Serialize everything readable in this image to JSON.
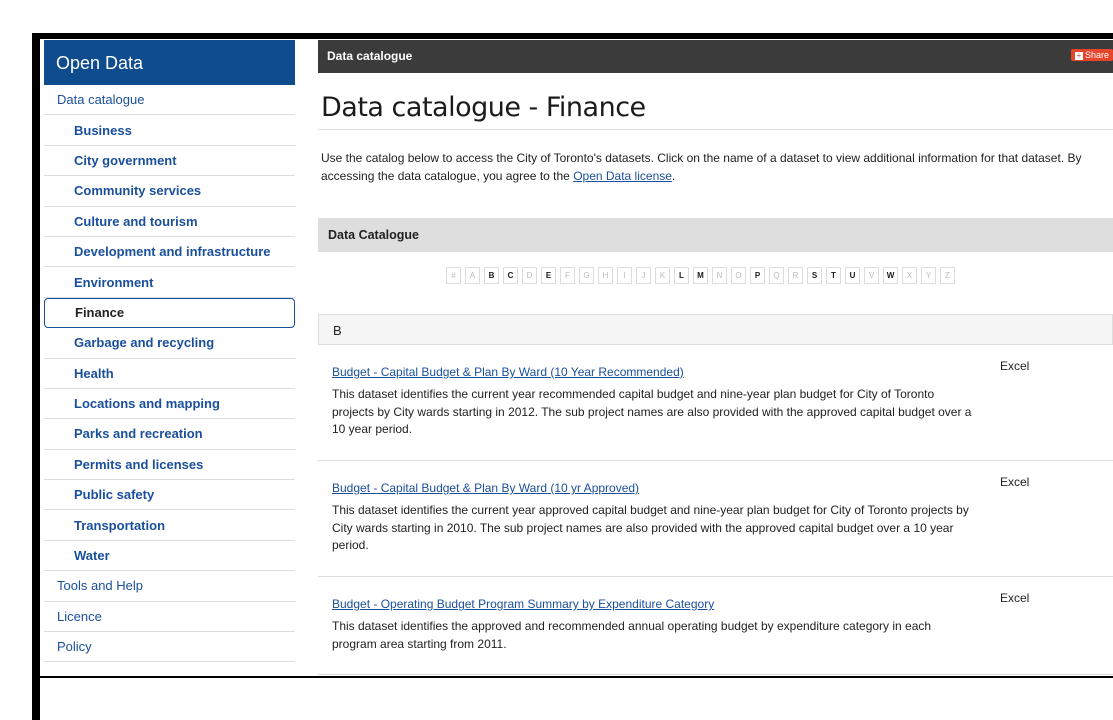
{
  "sidebar": {
    "title": "Open Data",
    "items": [
      {
        "label": "Data catalogue",
        "kind": "top"
      },
      {
        "label": "Business",
        "kind": "sub"
      },
      {
        "label": "City government",
        "kind": "sub"
      },
      {
        "label": "Community services",
        "kind": "sub"
      },
      {
        "label": "Culture and tourism",
        "kind": "sub"
      },
      {
        "label": "Development and infrastructure",
        "kind": "sub"
      },
      {
        "label": "Environment",
        "kind": "sub"
      },
      {
        "label": "Finance",
        "kind": "sub",
        "active": true
      },
      {
        "label": "Garbage and recycling",
        "kind": "sub"
      },
      {
        "label": "Health",
        "kind": "sub"
      },
      {
        "label": "Locations and mapping",
        "kind": "sub"
      },
      {
        "label": "Parks and recreation",
        "kind": "sub"
      },
      {
        "label": "Permits and licenses",
        "kind": "sub"
      },
      {
        "label": "Public safety",
        "kind": "sub"
      },
      {
        "label": "Transportation",
        "kind": "sub"
      },
      {
        "label": "Water",
        "kind": "sub"
      },
      {
        "label": "Tools and Help",
        "kind": "top"
      },
      {
        "label": "Licence",
        "kind": "top"
      },
      {
        "label": "Policy",
        "kind": "top"
      }
    ]
  },
  "topbar": {
    "label": "Data catalogue",
    "share": "Share"
  },
  "page": {
    "title": "Data catalogue - Finance",
    "intro_pre": "Use the catalog below to access the City of Toronto's datasets. Click on the name of a dataset to view additional information for that dataset. By accessing the data catalogue, you agree to the ",
    "intro_link": "Open Data license",
    "intro_post": ".",
    "catalogue_heading": "Data Catalogue"
  },
  "alphabet": [
    {
      "l": "#",
      "on": false
    },
    {
      "l": "A",
      "on": false
    },
    {
      "l": "B",
      "on": true
    },
    {
      "l": "C",
      "on": true
    },
    {
      "l": "D",
      "on": false
    },
    {
      "l": "E",
      "on": true
    },
    {
      "l": "F",
      "on": false
    },
    {
      "l": "G",
      "on": false
    },
    {
      "l": "H",
      "on": false
    },
    {
      "l": "I",
      "on": false
    },
    {
      "l": "J",
      "on": false
    },
    {
      "l": "K",
      "on": false
    },
    {
      "l": "L",
      "on": true
    },
    {
      "l": "M",
      "on": true
    },
    {
      "l": "N",
      "on": false
    },
    {
      "l": "O",
      "on": false
    },
    {
      "l": "P",
      "on": true
    },
    {
      "l": "Q",
      "on": false
    },
    {
      "l": "R",
      "on": false
    },
    {
      "l": "S",
      "on": true
    },
    {
      "l": "T",
      "on": true
    },
    {
      "l": "U",
      "on": true
    },
    {
      "l": "V",
      "on": false
    },
    {
      "l": "W",
      "on": true
    },
    {
      "l": "X",
      "on": false
    },
    {
      "l": "Y",
      "on": false
    },
    {
      "l": "Z",
      "on": false
    }
  ],
  "section": {
    "letter": "B"
  },
  "datasets": [
    {
      "name": "Budget - Capital Budget & Plan By Ward (10 Year Recommended)",
      "format": "Excel",
      "desc": "This dataset identifies the current year recommended capital budget and nine-year plan budget for City of Toronto projects by City wards starting in 2012. The sub project names are also provided with the approved capital budget over a 10 year period."
    },
    {
      "name": "Budget - Capital Budget & Plan By Ward (10 yr Approved)",
      "format": "Excel",
      "desc": "This dataset identifies the current year approved capital budget and nine-year plan budget for City of Toronto projects by City wards starting in 2010. The sub project names are also provided with the approved capital budget over a 10 year period."
    },
    {
      "name": "Budget - Operating Budget Program Summary by Expenditure Category",
      "format": "Excel",
      "desc": "This dataset identifies the approved and recommended annual operating budget by expenditure category in each program area starting from 2011."
    }
  ]
}
